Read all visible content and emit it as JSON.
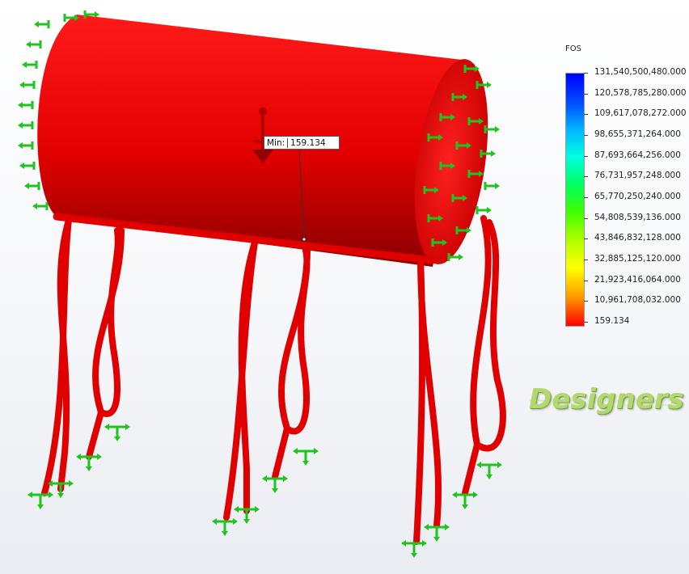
{
  "legend": {
    "title": "FOS",
    "labels": [
      "131,540,500,480.000",
      "120,578,785,280.000",
      "109,617,078,272.000",
      "98,655,371,264.000",
      "87,693,664,256.000",
      "76,731,957,248.000",
      "65,770,250,240.000",
      "54,808,539,136.000",
      "43,846,832,128.000",
      "32,885,125,120.000",
      "21,923,416,064.000",
      "10,961,708,032.000",
      "159.134"
    ]
  },
  "probe": {
    "label": "Min:",
    "value": "159.134"
  },
  "watermark": {
    "text": "Designers"
  },
  "colors": {
    "model": "#e60000",
    "fixture_arrows": "#22cc22",
    "load_arrow": "#cc0000"
  }
}
